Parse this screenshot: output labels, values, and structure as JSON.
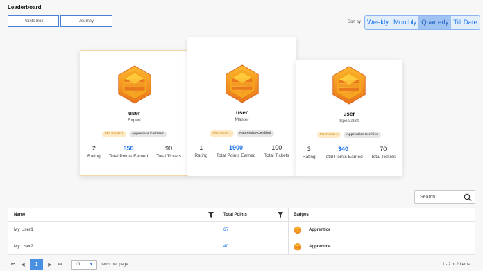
{
  "page": {
    "title": "Leaderboard"
  },
  "tabs": [
    {
      "label": "Points Box"
    },
    {
      "label": "Journey"
    }
  ],
  "sort": {
    "label": "Sort by",
    "options": [
      "Weekly",
      "Monthly",
      "Quarterly",
      "Till Date"
    ],
    "selected": "Quarterly"
  },
  "podium": [
    {
      "name": "user",
      "level": "Expert",
      "chips": [
        "Min.Points 1",
        "Apprentice Certified"
      ],
      "stats": [
        {
          "value": "2",
          "label": "Rating"
        },
        {
          "value": "850",
          "label": "Total Points Earned"
        },
        {
          "value": "90",
          "label": "Total Tickets"
        }
      ]
    },
    {
      "name": "user",
      "level": "Master",
      "chips": [
        "Min.Points 1",
        "Apprentice Certified"
      ],
      "stats": [
        {
          "value": "1",
          "label": "Rating"
        },
        {
          "value": "1900",
          "label": "Total Points Earned"
        },
        {
          "value": "100",
          "label": "Total Tickets"
        }
      ]
    },
    {
      "name": "user",
      "level": "Specialist",
      "chips": [
        "Min.Points 1",
        "Apprentice Certified"
      ],
      "stats": [
        {
          "value": "3",
          "label": "Rating"
        },
        {
          "value": "340",
          "label": "Total Points Earned"
        },
        {
          "value": "70",
          "label": "Total Tickets"
        }
      ]
    }
  ],
  "search": {
    "placeholder": "Search..."
  },
  "table": {
    "columns": [
      "Name",
      "Total Points",
      "Badges"
    ],
    "rows": [
      {
        "name": "My User1",
        "points": "67",
        "badge": "Apprentice"
      },
      {
        "name": "My User2",
        "points": "40",
        "badge": "Apprentice"
      }
    ]
  },
  "pager": {
    "current_page": "1",
    "per_page": "10",
    "per_page_label": "items per page",
    "range": "1 - 2 of 2 items"
  },
  "colors": {
    "accent": "#1a73e8",
    "badge_orange": "#f5a623",
    "chip_bg": "#fde9c4"
  }
}
